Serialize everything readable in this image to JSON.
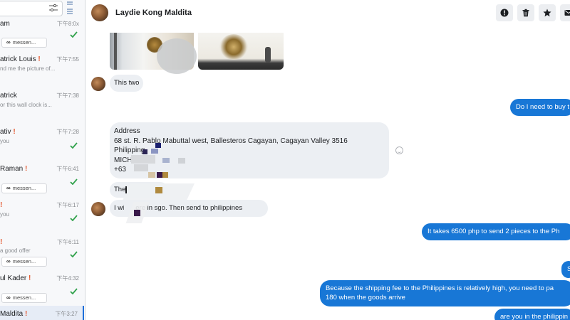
{
  "sidebar": {
    "conversations": [
      {
        "name": "am",
        "excl": "",
        "time": "下午8:0x",
        "snippet": "",
        "tag": "",
        "check": true
      },
      {
        "name": "atrick Louis",
        "excl": "!",
        "time": "下午7:55",
        "snippet": "nd me the picture of...",
        "tag": "",
        "check": false
      },
      {
        "name": "atrick",
        "excl": "",
        "time": "下午7:38",
        "snippet": "or this wall clock is...",
        "tag": "",
        "check": false
      },
      {
        "name": "ativ",
        "excl": "!",
        "time": "下午7:28",
        "snippet": "you",
        "tag": "",
        "check": true
      },
      {
        "name": "Raman",
        "excl": "!",
        "time": "下午6:41",
        "snippet": "",
        "tag": "messen...",
        "check": true
      },
      {
        "name": "",
        "excl": "!",
        "time": "下午6:17",
        "snippet": "you",
        "tag": "",
        "check": true
      },
      {
        "name": "",
        "excl": "!",
        "time": "下午6:11",
        "snippet": "a good offer",
        "tag": "messen...",
        "check": true
      },
      {
        "name": "ul Kader",
        "excl": "!",
        "time": "下午4:32",
        "snippet": "",
        "tag": "messen...",
        "check": true
      },
      {
        "name": "Maldita",
        "excl": "!",
        "time": "下午3:27",
        "snippet": "",
        "tag": "",
        "check": false
      }
    ],
    "top_tag": "messen...",
    "meta_glyph": "∞"
  },
  "header": {
    "contact_name": "Laydie Kong Maldita",
    "buttons": [
      "info-icon",
      "trash-icon",
      "star-icon",
      "mail-icon"
    ]
  },
  "messages": {
    "this_two": "This two",
    "do_i_need": "Do I need to buy t",
    "address": {
      "line1": "Address",
      "line2": "68 st. R. Pablo Mabuttal west, Ballesteros Cagayan, Cagayan Valley 3516",
      "line3": "Philipping",
      "line4": "MICHE",
      "line5": "+63"
    },
    "the": "The",
    "i_will": "I wi",
    "i_will_rest": "ere in sgo. Then send to philippines",
    "takes_6500": "It takes 6500 php to send 2 pieces to the Ph",
    "s_short": "S",
    "because_1": "Because the shipping fee to the Philippines is relatively high, you need to pa",
    "because_2": "180 when the goods arrive",
    "are_you": "are you in the philippin"
  },
  "colors": {
    "outgoing": "#1877d6",
    "incoming": "#eceff3",
    "check_green": "#31a24c",
    "excl_orange": "#e4572e"
  }
}
